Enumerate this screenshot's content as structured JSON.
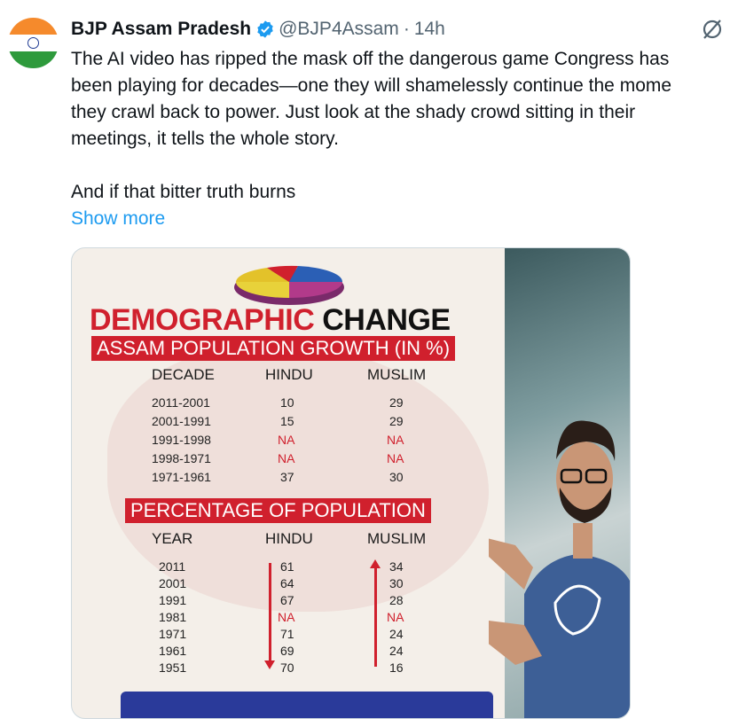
{
  "tweet": {
    "author_name": "BJP Assam Pradesh",
    "handle": "@BJP4Assam",
    "separator": "·",
    "time": "14h",
    "text_lines": [
      "The AI video has ripped the mask off the dangerous game Congress has",
      "been playing for decades—one they will shamelessly continue the mome",
      "they crawl back to power. Just look at the shady crowd sitting in their",
      "meetings, it tells the whole story."
    ],
    "text_line_after": "And if that bitter truth burns",
    "show_more": "Show more"
  },
  "infographic": {
    "headline_red": "DEMOGRAPHIC",
    "headline_dark": "CHANGE",
    "banner1": "ASSAM POPULATION GROWTH (IN %)",
    "table1": {
      "headers": [
        "DECADE",
        "HINDU",
        "MUSLIM"
      ],
      "rows": [
        [
          "2011-2001",
          "10",
          "29"
        ],
        [
          "2001-1991",
          "15",
          "29"
        ],
        [
          "1991-1998",
          "NA",
          "NA"
        ],
        [
          "1998-1971",
          "NA",
          "NA"
        ],
        [
          "1971-1961",
          "37",
          "30"
        ]
      ]
    },
    "banner2": "PERCENTAGE OF POPULATION",
    "table2": {
      "headers": [
        "YEAR",
        "HINDU",
        "MUSLIM"
      ],
      "rows": [
        [
          "2011",
          "61",
          "34"
        ],
        [
          "2001",
          "64",
          "30"
        ],
        [
          "1991",
          "67",
          "28"
        ],
        [
          "1981",
          "NA",
          "NA"
        ],
        [
          "1971",
          "71",
          "24"
        ],
        [
          "1961",
          "69",
          "24"
        ],
        [
          "1951",
          "70",
          "16"
        ]
      ]
    }
  },
  "colors": {
    "accent_link": "#1d9bf0",
    "verified": "#1d9bf0",
    "banner_red": "#d0202d",
    "secondary_text": "#536471"
  }
}
